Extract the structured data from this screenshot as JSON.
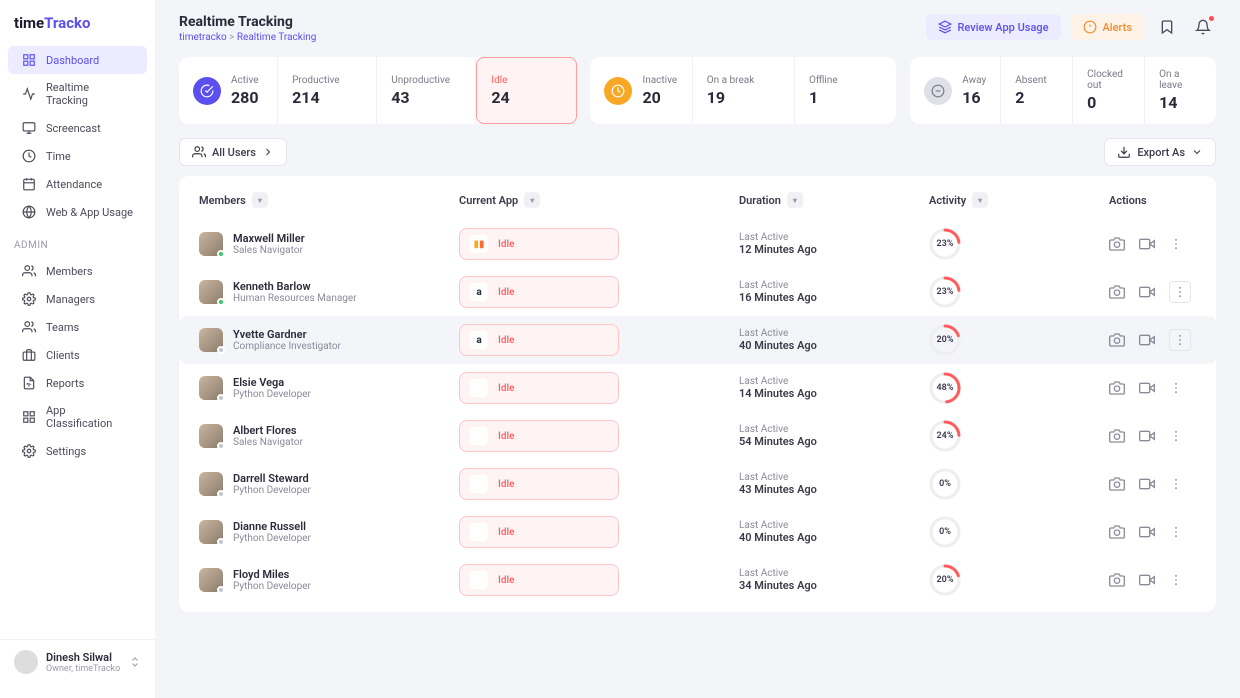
{
  "brand": {
    "p1": "time",
    "p2": "Tracko"
  },
  "nav": {
    "main": [
      {
        "icon": "grid",
        "label": "Dashboard",
        "active": true
      },
      {
        "icon": "pulse",
        "label": "Realtime Tracking"
      },
      {
        "icon": "monitor",
        "label": "Screencast"
      },
      {
        "icon": "clock",
        "label": "Time"
      },
      {
        "icon": "cal",
        "label": "Attendance"
      },
      {
        "icon": "globe",
        "label": "Web & App Usage"
      }
    ],
    "adminLabel": "ADMIN",
    "admin": [
      {
        "icon": "users",
        "label": "Members"
      },
      {
        "icon": "cog",
        "label": "Managers"
      },
      {
        "icon": "users",
        "label": "Teams"
      },
      {
        "icon": "briefcase",
        "label": "Clients"
      },
      {
        "icon": "report",
        "label": "Reports"
      },
      {
        "icon": "grid",
        "label": "App Classification"
      },
      {
        "icon": "cog",
        "label": "Settings"
      }
    ]
  },
  "footerUser": {
    "name": "Dinesh Silwal",
    "role": "Owner, timeTracko"
  },
  "header": {
    "title": "Realtime Tracking",
    "crumb1": "timetracko",
    "crumb2": "Realtime Tracking",
    "review": "Review App Usage",
    "alerts": "Alerts"
  },
  "stats": [
    {
      "icon": "purple",
      "label": "Active",
      "value": "280"
    },
    {
      "label": "Productive",
      "value": "214"
    },
    {
      "label": "Unproductive",
      "value": "43"
    },
    {
      "label": "Idle",
      "value": "24",
      "idle": true
    }
  ],
  "stats2": [
    {
      "icon": "orange",
      "label": "Inactive",
      "value": "20"
    },
    {
      "label": "On a break",
      "value": "19"
    },
    {
      "label": "Offline",
      "value": "1"
    }
  ],
  "stats3": [
    {
      "icon": "grey",
      "label": "Away",
      "value": "16"
    },
    {
      "label": "Absent",
      "value": "2"
    },
    {
      "label": "Clocked out",
      "value": "0"
    },
    {
      "label": "On a leave",
      "value": "14"
    }
  ],
  "filters": {
    "allUsers": "All Users",
    "export": "Export As"
  },
  "columns": {
    "members": "Members",
    "app": "Current App",
    "duration": "Duration",
    "activity": "Activity",
    "actions": "Actions"
  },
  "rows": [
    {
      "name": "Maxwell Miller",
      "role": "Sales Navigator",
      "st": "on",
      "app": "ga",
      "appTxt": "Idle",
      "durLbl": "Last Active",
      "durVal": "12 Minutes Ago",
      "pct": 23
    },
    {
      "name": "Kenneth Barlow",
      "role": "Human Resources Manager",
      "st": "on",
      "app": "amz",
      "appTxt": "Idle",
      "durLbl": "Last Active",
      "durVal": "16 Minutes Ago",
      "pct": 23,
      "boxed": true
    },
    {
      "name": "Yvette Gardner",
      "role": "Compliance Investigator",
      "st": "off",
      "app": "amz",
      "appTxt": "Idle",
      "durLbl": "Last Active",
      "durVal": "40 Minutes Ago",
      "pct": 20,
      "hov": true,
      "boxed": true
    },
    {
      "name": "Elsie Vega",
      "role": "Python Developer",
      "st": "off",
      "app": "",
      "appTxt": "Idle",
      "durLbl": "Last Active",
      "durVal": "14 Minutes Ago",
      "pct": 48
    },
    {
      "name": "Albert Flores",
      "role": "Sales Navigator",
      "st": "off",
      "app": "",
      "appTxt": "Idle",
      "durLbl": "Last Active",
      "durVal": "54 Minutes Ago",
      "pct": 24
    },
    {
      "name": "Darrell Steward",
      "role": "Python Developer",
      "st": "off",
      "app": "",
      "appTxt": "Idle",
      "durLbl": "Last Active",
      "durVal": "43 Minutes Ago",
      "pct": 0
    },
    {
      "name": "Dianne Russell",
      "role": "Python Developer",
      "st": "off",
      "app": "",
      "appTxt": "Idle",
      "durLbl": "Last Active",
      "durVal": "40 Minutes Ago",
      "pct": 0
    },
    {
      "name": "Floyd Miles",
      "role": "Python Developer",
      "st": "off",
      "app": "",
      "appTxt": "Idle",
      "durLbl": "Last Active",
      "durVal": "34 Minutes Ago",
      "pct": 20
    }
  ]
}
